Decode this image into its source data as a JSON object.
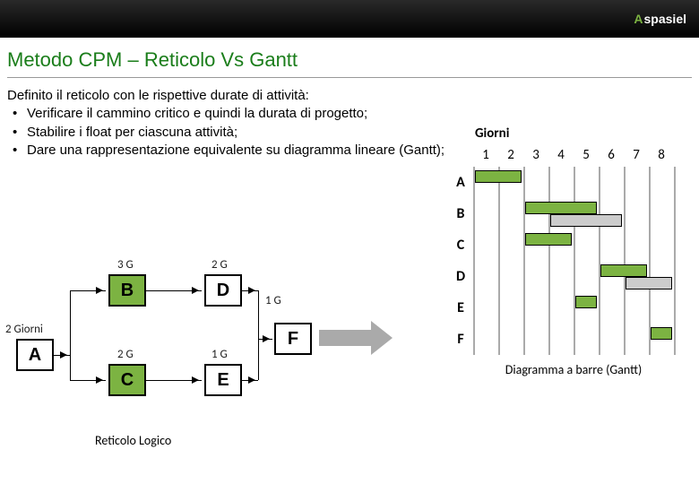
{
  "header": {
    "logo_text": "spasiel"
  },
  "title": "Metodo CPM – Reticolo Vs Gantt",
  "intro": "Definito il reticolo con le rispettive durate di attività:",
  "bullets": [
    "Verificare il cammino critico e quindi la durata di progetto;",
    "Stabilire i float per ciascuna attività;",
    "Dare una rappresentazione equivalente su diagramma lineare (Gantt);"
  ],
  "reticolo": {
    "left_label": "2 Giorni",
    "nodes": {
      "A": "A",
      "B": "B",
      "C": "C",
      "D": "D",
      "E": "E",
      "F": "F"
    },
    "durations": {
      "bd_top": "3 G",
      "d_top": "2 G",
      "c_top": "2 G",
      "e_top": "1 G",
      "df": "1 G"
    },
    "caption": "Reticolo Logico"
  },
  "gantt": {
    "title": "Giorni",
    "days": [
      "1",
      "2",
      "3",
      "4",
      "5",
      "6",
      "7",
      "8"
    ],
    "rows": [
      "A",
      "B",
      "C",
      "D",
      "E",
      "F"
    ],
    "caption": "Diagramma a barre (Gantt)"
  },
  "chart_data": {
    "type": "gantt",
    "days": 8,
    "tasks": [
      {
        "name": "A",
        "critical": [
          1,
          2
        ],
        "float": null
      },
      {
        "name": "B",
        "critical": [
          3,
          5
        ],
        "float": [
          4,
          6
        ]
      },
      {
        "name": "C",
        "critical": [
          3,
          4
        ],
        "float": null
      },
      {
        "name": "D",
        "critical": [
          6,
          7
        ],
        "float": [
          7,
          8
        ]
      },
      {
        "name": "E",
        "critical": [
          5,
          5
        ],
        "float": null
      },
      {
        "name": "F",
        "critical": [
          8,
          8
        ],
        "float": null
      }
    ],
    "network": {
      "nodes": [
        "A",
        "B",
        "C",
        "D",
        "E",
        "F"
      ],
      "durations": {
        "A": 2,
        "B": 3,
        "C": 2,
        "D": 2,
        "E": 1,
        "F": 1
      },
      "edges": [
        [
          "A",
          "B"
        ],
        [
          "A",
          "C"
        ],
        [
          "B",
          "D"
        ],
        [
          "C",
          "E"
        ],
        [
          "D",
          "F"
        ],
        [
          "E",
          "F"
        ]
      ]
    }
  }
}
